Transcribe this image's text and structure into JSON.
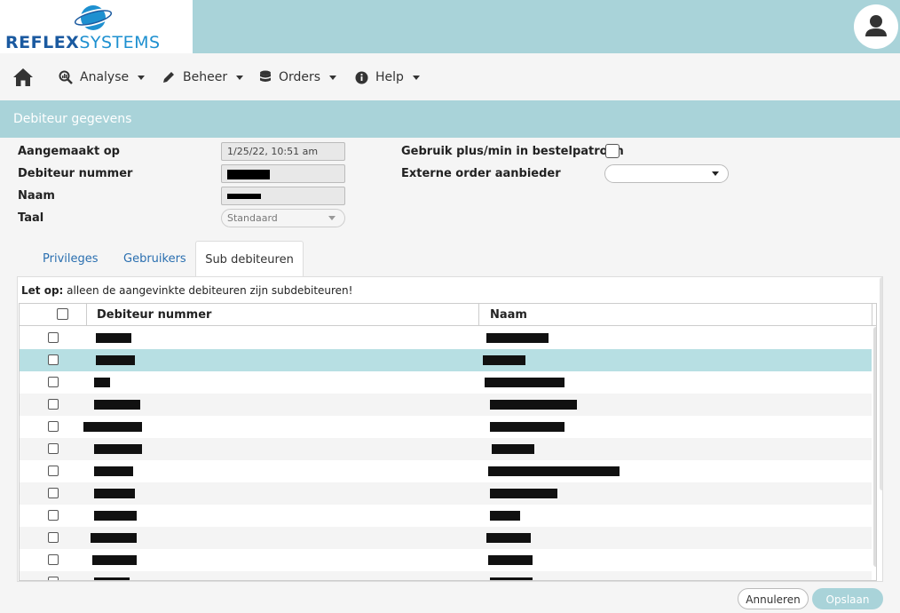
{
  "app": {
    "logo_text_bold": "REFLEX",
    "logo_text_light": "SYSTEMS",
    "accent_color": "#a9d3d9",
    "brand_blue": "#1b5aa0"
  },
  "header": {
    "user_icon": "user-icon"
  },
  "nav": {
    "home_icon": "home-icon",
    "items": [
      {
        "label": "Analyse",
        "icon": "analytics-search-icon"
      },
      {
        "label": "Beheer",
        "icon": "pencil-icon"
      },
      {
        "label": "Orders",
        "icon": "database-icon"
      },
      {
        "label": "Help",
        "icon": "info-icon"
      }
    ]
  },
  "section": {
    "title": "Debiteur gegevens"
  },
  "form": {
    "created_label": "Aangemaakt op",
    "created_value": "1/25/22, 10:51 am",
    "debtor_number_label": "Debiteur nummer",
    "name_label": "Naam",
    "language_label": "Taal",
    "language_value": "Standaard",
    "plusmin_label": "Gebruik plus/min in bestelpatroon",
    "external_label": "Externe order aanbieder",
    "external_value": ""
  },
  "tabs": [
    {
      "label": "Privileges",
      "active": false
    },
    {
      "label": "Gebruikers",
      "active": false
    },
    {
      "label": "Sub debiteuren",
      "active": true
    }
  ],
  "subdebtors": {
    "note_bold": "Let op:",
    "note_text": " alleen de aangevinkte debiteuren zijn subdebiteuren!",
    "columns": [
      "Debiteur nummer",
      "Naam"
    ],
    "rows": [
      {
        "selected": false
      },
      {
        "selected": true
      },
      {
        "selected": false
      },
      {
        "selected": false
      },
      {
        "selected": false
      },
      {
        "selected": false
      },
      {
        "selected": false
      },
      {
        "selected": false
      },
      {
        "selected": false
      },
      {
        "selected": false
      },
      {
        "selected": false
      },
      {
        "selected": false
      }
    ]
  },
  "buttons": {
    "cancel": "Annuleren",
    "save": "Opslaan"
  }
}
